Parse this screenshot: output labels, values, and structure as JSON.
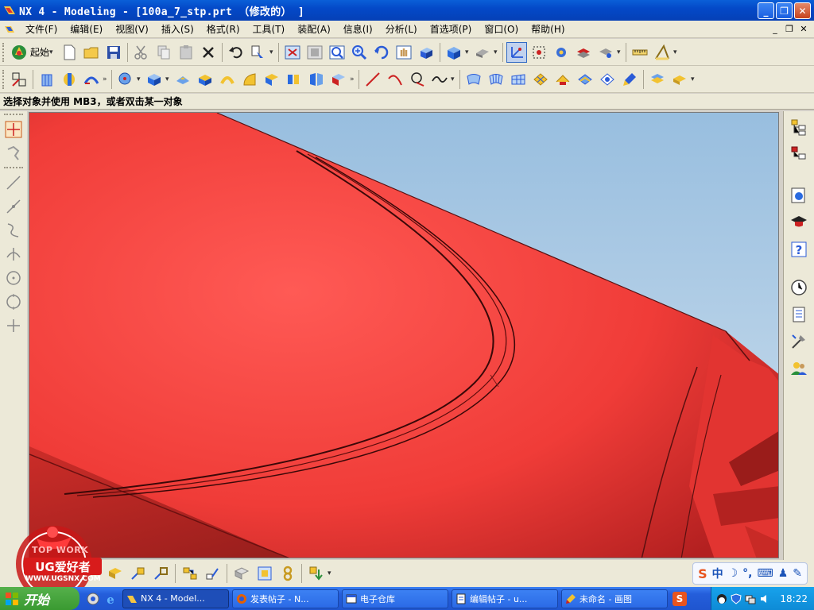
{
  "title_bar": {
    "title": "NX 4 - Modeling - [100a_7_stp.prt （修改的） ]",
    "minimize_label": "_",
    "maximize_label": "❐",
    "close_label": "✕"
  },
  "menu": {
    "items": [
      "文件(F)",
      "编辑(E)",
      "视图(V)",
      "插入(S)",
      "格式(R)",
      "工具(T)",
      "装配(A)",
      "信息(I)",
      "分析(L)",
      "首选项(P)",
      "窗口(O)",
      "帮助(H)"
    ]
  },
  "toolbar": {
    "start_label": "起始"
  },
  "prompt": {
    "text": "选择对象并使用 MB3，或者双击某一对象"
  },
  "watermark": {
    "top_text": "TOP WORK",
    "brand": "UG爱好者",
    "url": "WWW.UGSNX.COM"
  },
  "ime": {
    "label": "中"
  },
  "taskbar": {
    "start_label": "开始",
    "tasks": [
      {
        "label": "NX 4 - Model..."
      },
      {
        "label": "发表帖子 - N..."
      },
      {
        "label": "电子仓库"
      },
      {
        "label": "编辑帖子 - u..."
      },
      {
        "label": "未命名 - 画图"
      }
    ],
    "clock": "18:22"
  },
  "colors": {
    "titlebar": "#0449c8",
    "model_red": "#f23a3a",
    "background_sky": "#a8c8e4",
    "panel": "#ece9d8"
  }
}
